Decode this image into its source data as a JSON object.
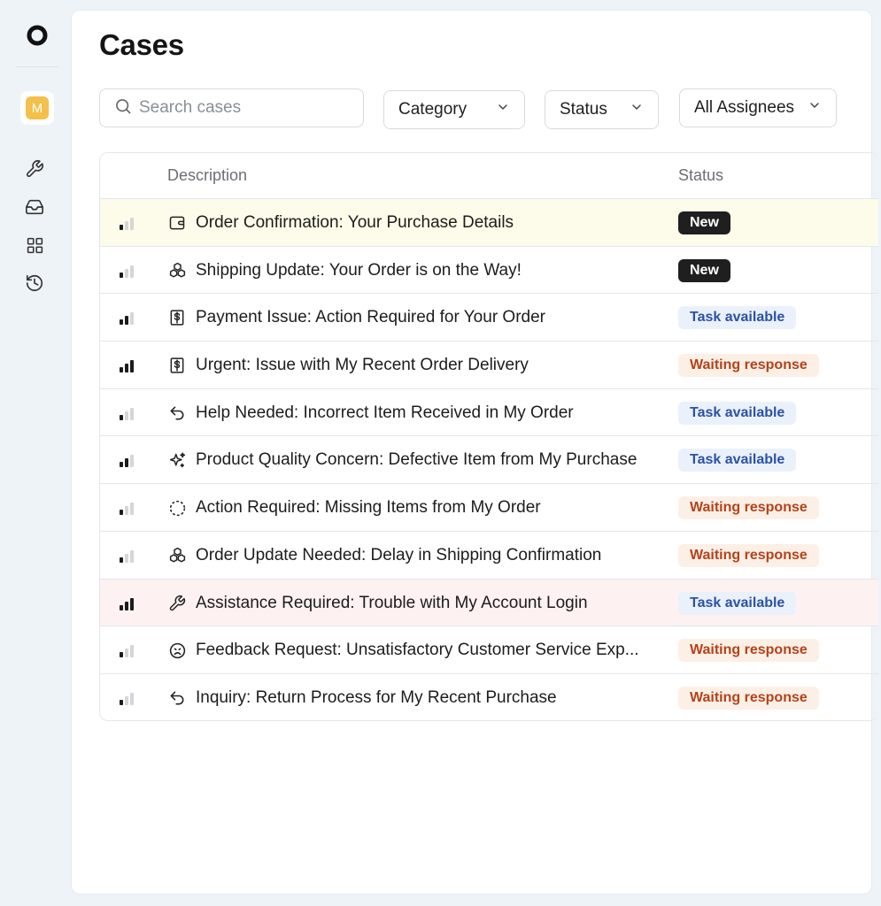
{
  "sidebar": {
    "avatar_initial": "M",
    "nav_icons": [
      "wrench-icon",
      "inbox-icon",
      "grid-icon",
      "history-icon"
    ]
  },
  "page": {
    "title": "Cases"
  },
  "filters": {
    "search_placeholder": "Search cases",
    "category": "Category",
    "status": "Status",
    "assignees": "All Assignees"
  },
  "table": {
    "headers": {
      "description": "Description",
      "status": "Status"
    },
    "rows": [
      {
        "priority": 1,
        "icon": "wallet-icon",
        "description": "Order Confirmation: Your Purchase Details",
        "status": "New",
        "status_type": "new",
        "highlight": "yellow"
      },
      {
        "priority": 1,
        "icon": "boxes-icon",
        "description": "Shipping Update: Your Order is on the Way!",
        "status": "New",
        "status_type": "new",
        "highlight": ""
      },
      {
        "priority": 2,
        "icon": "dollar-receipt-icon",
        "description": "Payment Issue: Action Required for Your Order",
        "status": "Task available",
        "status_type": "task",
        "highlight": ""
      },
      {
        "priority": 3,
        "icon": "dollar-receipt-icon",
        "description": "Urgent: Issue with My Recent Order Delivery",
        "status": "Waiting response",
        "status_type": "wait",
        "highlight": ""
      },
      {
        "priority": 1,
        "icon": "reply-arrow-icon",
        "description": "Help Needed: Incorrect Item Received in My Order",
        "status": "Task available",
        "status_type": "task",
        "highlight": ""
      },
      {
        "priority": 2,
        "icon": "sparkles-icon",
        "description": "Product Quality Concern: Defective Item from My Purchase",
        "status": "Task available",
        "status_type": "task",
        "highlight": ""
      },
      {
        "priority": 1,
        "icon": "dashed-circle-icon",
        "description": "Action Required: Missing Items from My Order",
        "status": "Waiting response",
        "status_type": "wait",
        "highlight": ""
      },
      {
        "priority": 1,
        "icon": "boxes-icon",
        "description": "Order Update Needed: Delay in Shipping Confirmation",
        "status": "Waiting response",
        "status_type": "wait",
        "highlight": ""
      },
      {
        "priority": 3,
        "icon": "wrench-icon",
        "description": "Assistance Required: Trouble with My Account Login",
        "status": "Task available",
        "status_type": "task",
        "highlight": "red"
      },
      {
        "priority": 1,
        "icon": "frown-face-icon",
        "description": "Feedback Request: Unsatisfactory Customer Service Exp...",
        "status": "Waiting response",
        "status_type": "wait",
        "highlight": ""
      },
      {
        "priority": 1,
        "icon": "reply-arrow-icon",
        "description": "Inquiry: Return Process for My Recent Purchase",
        "status": "Waiting response",
        "status_type": "wait",
        "highlight": ""
      }
    ]
  }
}
